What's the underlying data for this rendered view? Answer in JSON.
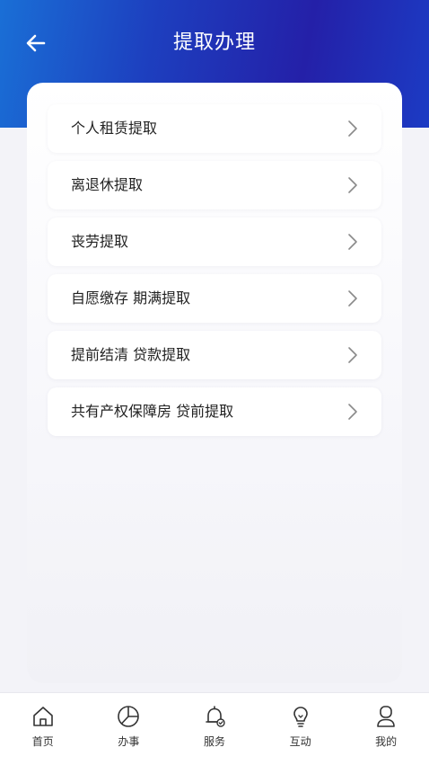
{
  "header": {
    "title": "提取办理",
    "back_icon": "arrow-left-icon"
  },
  "items": [
    {
      "label": "个人租赁提取"
    },
    {
      "label": "离退休提取"
    },
    {
      "label": "丧劳提取"
    },
    {
      "label": "自愿缴存 期满提取"
    },
    {
      "label": "提前结清 贷款提取"
    },
    {
      "label": "共有产权保障房 贷前提取"
    }
  ],
  "tabbar": [
    {
      "label": "首页",
      "icon": "home-icon"
    },
    {
      "label": "办事",
      "icon": "pie-chart-icon"
    },
    {
      "label": "服务",
      "icon": "bell-icon"
    },
    {
      "label": "互动",
      "icon": "lightbulb-icon"
    },
    {
      "label": "我的",
      "icon": "user-icon"
    }
  ],
  "colors": {
    "header_start": "#1a6fd6",
    "header_mid": "#2420a8",
    "text": "#222222"
  }
}
